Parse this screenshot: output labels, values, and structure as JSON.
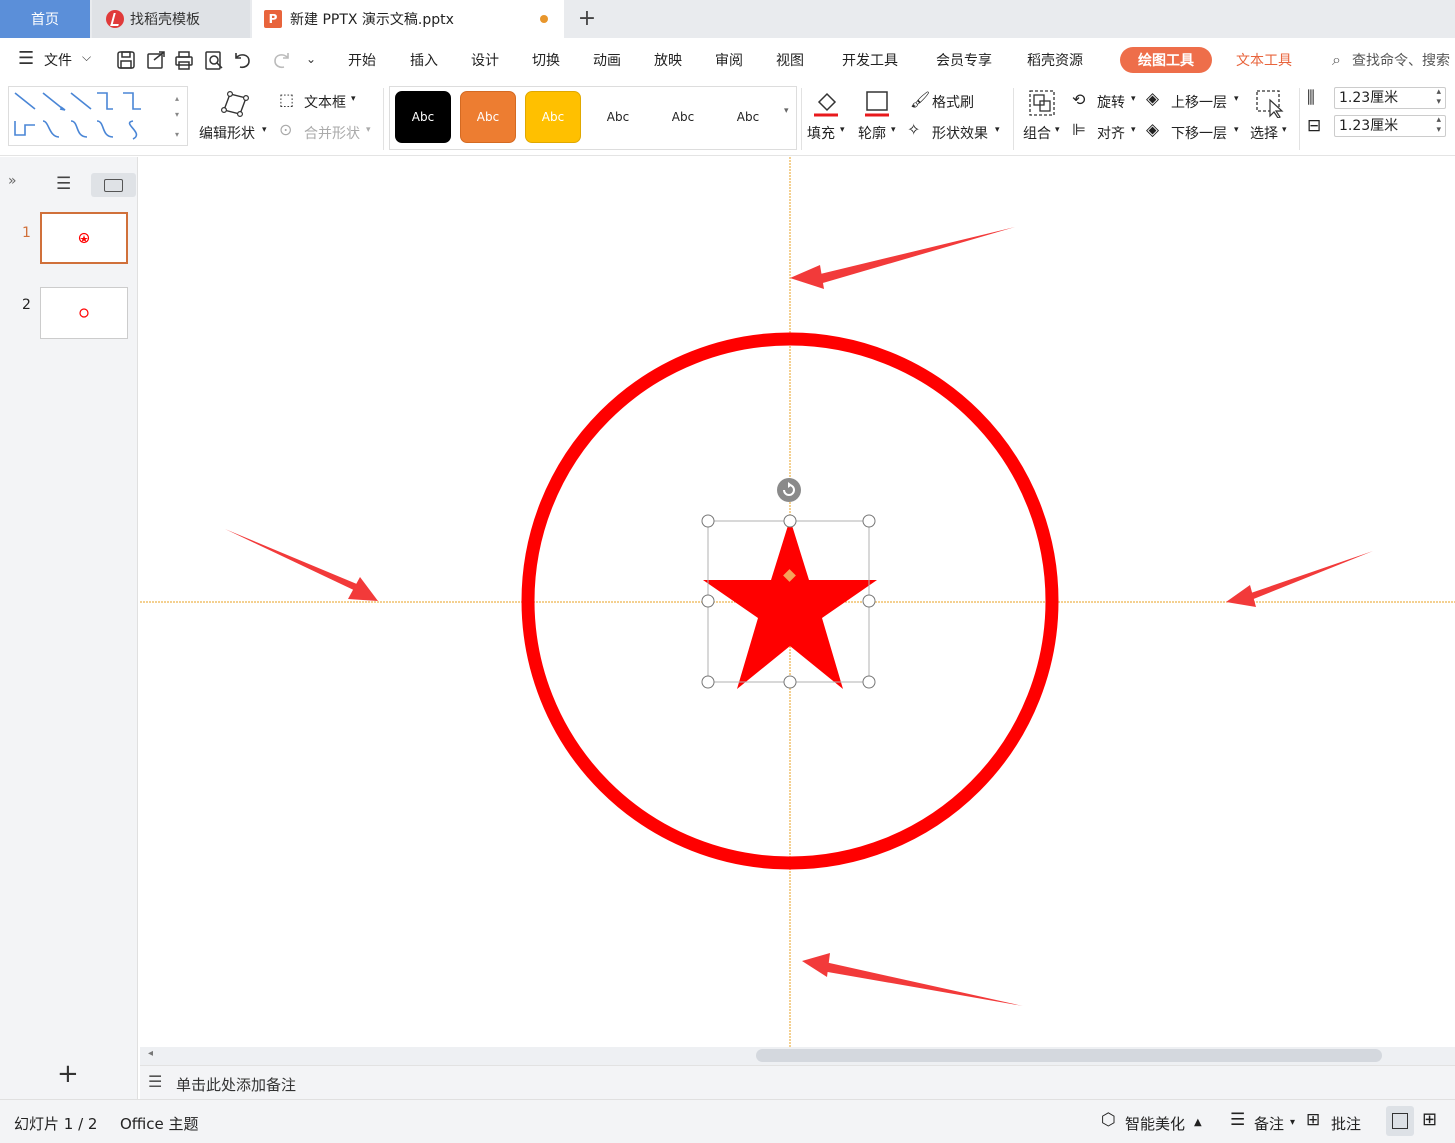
{
  "tabs": {
    "home": "首页",
    "template": "找稻壳模板",
    "document": "新建 PPTX 演示文稿.pptx",
    "add": "+"
  },
  "menu": {
    "file": "文件",
    "items": [
      "开始",
      "插入",
      "设计",
      "切换",
      "动画",
      "放映",
      "审阅",
      "视图",
      "开发工具",
      "会员专享",
      "稻壳资源"
    ],
    "active": "绘图工具",
    "text_tool": "文本工具",
    "search": "查找命令、搜索"
  },
  "ribbon": {
    "edit_shape": "编辑形状",
    "text_box": "文本框",
    "merge_shape": "合并形状",
    "styles": [
      {
        "label": "Abc",
        "bg": "#ffffff",
        "border": "#6fb04a",
        "color": "#222222"
      },
      {
        "label": "Abc",
        "bg": "#000000",
        "border": "#000000",
        "color": "#ffffff"
      },
      {
        "label": "Abc",
        "bg": "#5b9bd5",
        "border": "#4a86bf",
        "color": "#ffffff"
      },
      {
        "label": "Abc",
        "bg": "#ed7d31",
        "border": "#d46a22",
        "color": "#ffffff"
      },
      {
        "label": "Abc",
        "bg": "#a5a5a5",
        "border": "#8f8f8f",
        "color": "#ffffff"
      },
      {
        "label": "Abc",
        "bg": "#ffc000",
        "border": "#e0a800",
        "color": "#ffffff"
      }
    ],
    "fill": "填充",
    "outline": "轮廓",
    "format_brush": "格式刷",
    "shape_effect": "形状效果",
    "group": "组合",
    "rotate": "旋转",
    "align": "对齐",
    "bring_forward": "上移一层",
    "send_backward": "下移一层",
    "select": "选择",
    "height": "1.23厘米",
    "width": "1.23厘米"
  },
  "slides": {
    "numbers": [
      "1",
      "2"
    ],
    "active": 1
  },
  "notes_placeholder": "单击此处添加备注",
  "status": {
    "slide_info": "幻灯片 1 / 2",
    "theme": "Office 主题",
    "smart_beautify": "智能美化",
    "notes": "备注",
    "comments": "批注"
  },
  "colors": {
    "accent": "#ee6e4a",
    "shape_red": "#ff0000",
    "arrow_red": "#f23a3a",
    "guide": "#e8a020"
  }
}
